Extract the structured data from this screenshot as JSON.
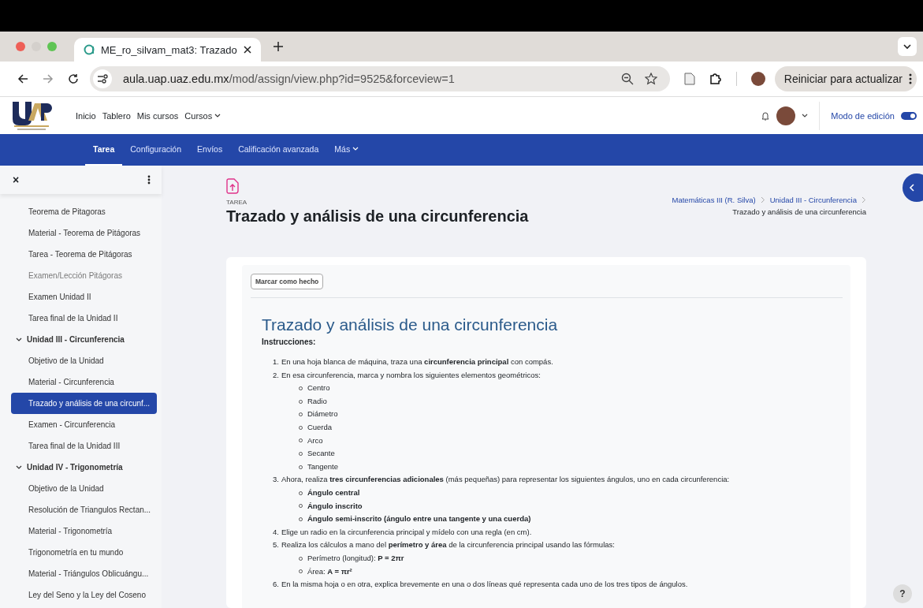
{
  "browser": {
    "tab": {
      "title": "ME_ro_silvam_mat3: Trazado",
      "selected": true
    },
    "url": {
      "host": "aula.uap.uaz.edu.mx",
      "path": "/mod/assign/view.php?id=9525&forceview=1"
    },
    "update_button": "Reiniciar para actualizar"
  },
  "top_nav": {
    "links": [
      {
        "label": "Inicio",
        "dropdown": false
      },
      {
        "label": "Tablero",
        "dropdown": false
      },
      {
        "label": "Mis cursos",
        "dropdown": false
      },
      {
        "label": "Cursos",
        "dropdown": true
      }
    ],
    "edit_mode": {
      "label": "Modo de edición",
      "on": true
    }
  },
  "secondary_nav": [
    {
      "label": "Tarea",
      "selected": true,
      "dropdown": false
    },
    {
      "label": "Configuración",
      "selected": false,
      "dropdown": false
    },
    {
      "label": "Envíos",
      "selected": false,
      "dropdown": false
    },
    {
      "label": "Calificación avanzada",
      "selected": false,
      "dropdown": false
    },
    {
      "label": "Más",
      "selected": false,
      "dropdown": true
    }
  ],
  "sidebar": {
    "close": "×",
    "items": [
      {
        "kind": "activity",
        "label": "Teorema de Pitagoras",
        "selected": false,
        "dimmed": false
      },
      {
        "kind": "activity",
        "label": "Material - Teorema de Pitágoras",
        "selected": false,
        "dimmed": false
      },
      {
        "kind": "activity",
        "label": "Tarea - Teorema de Pitágoras",
        "selected": false,
        "dimmed": false
      },
      {
        "kind": "activity",
        "label": "Examen/Lección Pitágoras",
        "selected": false,
        "dimmed": true
      },
      {
        "kind": "activity",
        "label": "Examen Unidad II",
        "selected": false,
        "dimmed": false
      },
      {
        "kind": "activity",
        "label": "Tarea final de la Unidad II",
        "selected": false,
        "dimmed": false
      },
      {
        "kind": "section",
        "label": "Unidad III - Circunferencia",
        "expanded": true,
        "children": [
          {
            "label": "Objetivo de la Unidad",
            "selected": false,
            "dimmed": false
          },
          {
            "label": "Material - Circunferencia",
            "selected": false,
            "dimmed": false
          },
          {
            "label": "Trazado y análisis de una circunf...",
            "selected": true,
            "dimmed": false
          },
          {
            "label": "Examen - Circunferencia",
            "selected": false,
            "dimmed": false
          },
          {
            "label": "Tarea final de la Unidad III",
            "selected": false,
            "dimmed": false
          }
        ]
      },
      {
        "kind": "section",
        "label": "Unidad IV - Trigonometría",
        "expanded": true,
        "children": [
          {
            "label": "Objetivo de la Unidad",
            "selected": false,
            "dimmed": false
          },
          {
            "label": "Resolución de Triangulos Rectan...",
            "selected": false,
            "dimmed": false
          },
          {
            "label": "Material - Trigonometría",
            "selected": false,
            "dimmed": false
          },
          {
            "label": "Trigonometría en tu mundo",
            "selected": false,
            "dimmed": false
          },
          {
            "label": "Material - Triángulos Oblicuángu...",
            "selected": false,
            "dimmed": false
          },
          {
            "label": "Ley del Seno y la Ley del Coseno",
            "selected": false,
            "dimmed": false
          }
        ]
      }
    ]
  },
  "page_header": {
    "type_label": "TAREA",
    "title": "Trazado y análisis de una circunferencia",
    "breadcrumb": [
      {
        "label": "Matemáticas III (R. Silva)",
        "link": true
      },
      {
        "label": "Unidad III - Circunferencia",
        "link": true
      },
      {
        "label": "Trazado y análisis de una circunferencia",
        "link": false
      }
    ]
  },
  "content": {
    "mark_done_button": "Marcar como hecho",
    "title": "Trazado y análisis de una circunferencia",
    "instructions_label": "Instrucciones:",
    "steps": [
      {
        "number": "1.",
        "text": "En una hoja blanca de máquina, traza una **circunferencia principal** con compás."
      },
      {
        "number": "2.",
        "text": "En esa circunferencia, marca y nombra los siguientes elementos geométricos:",
        "subitems": [
          {
            "text": "Centro",
            "bold": false
          },
          {
            "text": "Radio",
            "bold": false
          },
          {
            "text": "Diámetro",
            "bold": false
          },
          {
            "text": "Cuerda",
            "bold": false
          },
          {
            "text": "Arco",
            "bold": false
          },
          {
            "text": "Secante",
            "bold": false
          },
          {
            "text": "Tangente",
            "bold": false
          }
        ]
      },
      {
        "number": "3.",
        "text": "Ahora, realiza **tres circunferencias adicionales** (más pequeñas) para representar los siguientes ángulos, uno en cada circunferencia:",
        "subitems": [
          {
            "text": "Ángulo central",
            "bold": true
          },
          {
            "text": "Ángulo inscrito",
            "bold": true
          },
          {
            "text": "Ángulo semi-inscrito (ángulo entre una tangente y una cuerda)",
            "bold": true
          }
        ]
      },
      {
        "number": "4.",
        "text": "Elige un radio en la circunferencia principal y mídelo con una regla (en cm)."
      },
      {
        "number": "5.",
        "text": "Realiza los cálculos a mano del **perímetro y área** de la circunferencia principal usando las fórmulas:",
        "subitems": [
          {
            "text": "Perímetro (longitud): **P = 2πr**",
            "bold": false
          },
          {
            "text": "Área: **A = πr²**",
            "bold": false
          }
        ]
      },
      {
        "number": "6.",
        "text": "En la misma hoja o en otra, explica brevemente en una o dos líneas qué representa cada uno de los tres tipos de ángulos."
      }
    ]
  },
  "help_button": "?"
}
